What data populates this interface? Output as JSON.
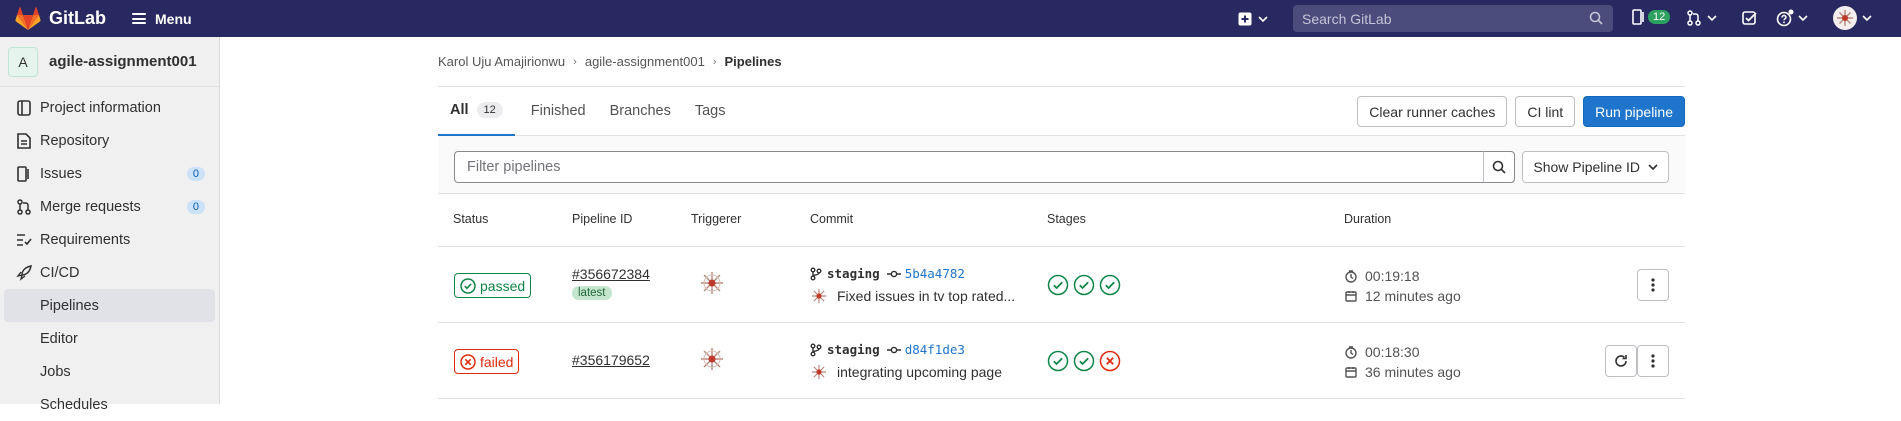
{
  "topbar": {
    "brand": "GitLab",
    "menu_label": "Menu",
    "search_placeholder": "Search GitLab",
    "issues_count": "12",
    "colors": {
      "bg": "#292961",
      "search_bg": "#4b4b7c",
      "accent_green": "#2da160"
    }
  },
  "sidebar": {
    "project_initial": "A",
    "project_name": "agile-assignment001",
    "items": [
      {
        "label": "Project information",
        "icon": "project-info-icon"
      },
      {
        "label": "Repository",
        "icon": "repository-icon"
      },
      {
        "label": "Issues",
        "icon": "issues-icon",
        "count": "0"
      },
      {
        "label": "Merge requests",
        "icon": "merge-request-icon",
        "count": "0"
      },
      {
        "label": "Requirements",
        "icon": "requirements-icon"
      },
      {
        "label": "CI/CD",
        "icon": "rocket-icon"
      }
    ],
    "subitems": [
      {
        "label": "Pipelines",
        "active": true
      },
      {
        "label": "Editor"
      },
      {
        "label": "Jobs"
      },
      {
        "label": "Schedules"
      }
    ]
  },
  "breadcrumb": {
    "items": [
      "Karol Uju Amajirionwu",
      "agile-assignment001",
      "Pipelines"
    ]
  },
  "tabs": [
    {
      "label": "All",
      "count": "12",
      "active": true
    },
    {
      "label": "Finished"
    },
    {
      "label": "Branches"
    },
    {
      "label": "Tags"
    }
  ],
  "actions": {
    "clear_cache": "Clear runner caches",
    "ci_lint": "CI lint",
    "run_pipeline": "Run pipeline"
  },
  "filter": {
    "placeholder": "Filter pipelines",
    "show_id": "Show Pipeline ID"
  },
  "table": {
    "headers": [
      "Status",
      "Pipeline ID",
      "Triggerer",
      "Commit",
      "Stages",
      "Duration"
    ],
    "rows": [
      {
        "status": "passed",
        "pipeline_id": "#356672384",
        "badge": "latest",
        "ref": "staging",
        "sha": "5b4a4782",
        "message": "Fixed issues in tv top rated...",
        "stages": [
          "success",
          "success",
          "success"
        ],
        "duration": "00:19:18",
        "finished": "12 minutes ago"
      },
      {
        "status": "failed",
        "pipeline_id": "#356179652",
        "badge": "",
        "ref": "staging",
        "sha": "d84f1de3",
        "message": "integrating upcoming page",
        "stages": [
          "success",
          "success",
          "failed"
        ],
        "duration": "00:18:30",
        "finished": "36 minutes ago"
      }
    ]
  }
}
